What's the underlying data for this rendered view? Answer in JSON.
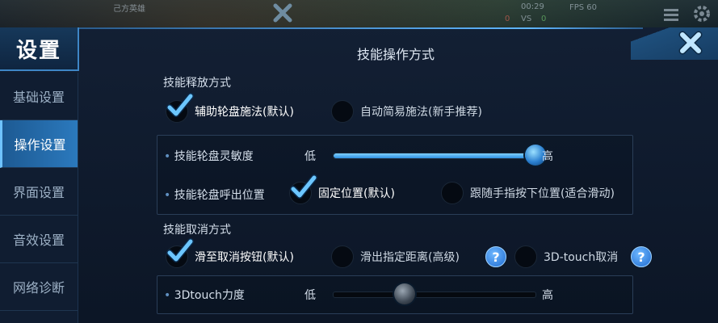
{
  "hud": {
    "team_label": "己方英雄",
    "time": "00:29",
    "vs": "VS",
    "fps": "FPS 60",
    "red_score": "0",
    "green_score": "0",
    "colors": {
      "accent": "#2b79bd",
      "highlight": "#6fc3ff",
      "danger": "#ff6a5a",
      "success": "#7fe07a"
    }
  },
  "window": {
    "title": "设置",
    "close_icon": "close-x-icon"
  },
  "sidebar": {
    "items": [
      {
        "label": "基础设置",
        "active": false
      },
      {
        "label": "操作设置",
        "active": true
      },
      {
        "label": "界面设置",
        "active": false
      },
      {
        "label": "音效设置",
        "active": false
      },
      {
        "label": "网络诊断",
        "active": false
      }
    ]
  },
  "content": {
    "title": "技能操作方式",
    "release": {
      "title": "技能释放方式",
      "options": [
        {
          "label": "辅助轮盘施法(默认)",
          "selected": true
        },
        {
          "label": "自动简易施法(新手推荐)",
          "selected": false
        }
      ]
    },
    "sensitivity": {
      "label": "技能轮盘灵敏度",
      "low": "低",
      "high": "高",
      "value": 1.0
    },
    "position": {
      "label": "技能轮盘呼出位置",
      "options": [
        {
          "label": "固定位置(默认)",
          "selected": true
        },
        {
          "label": "跟随手指按下位置(适合滑动)",
          "selected": false
        }
      ]
    },
    "cancel": {
      "title": "技能取消方式",
      "options": [
        {
          "label": "滑至取消按钮(默认)",
          "selected": true
        },
        {
          "label": "滑出指定距离(高级)",
          "selected": false,
          "help": "?"
        },
        {
          "label": "3D-touch取消",
          "selected": false,
          "help": "?"
        }
      ]
    },
    "force": {
      "label": "3Dtouch力度",
      "low": "低",
      "high": "高",
      "value": 0.35
    }
  }
}
